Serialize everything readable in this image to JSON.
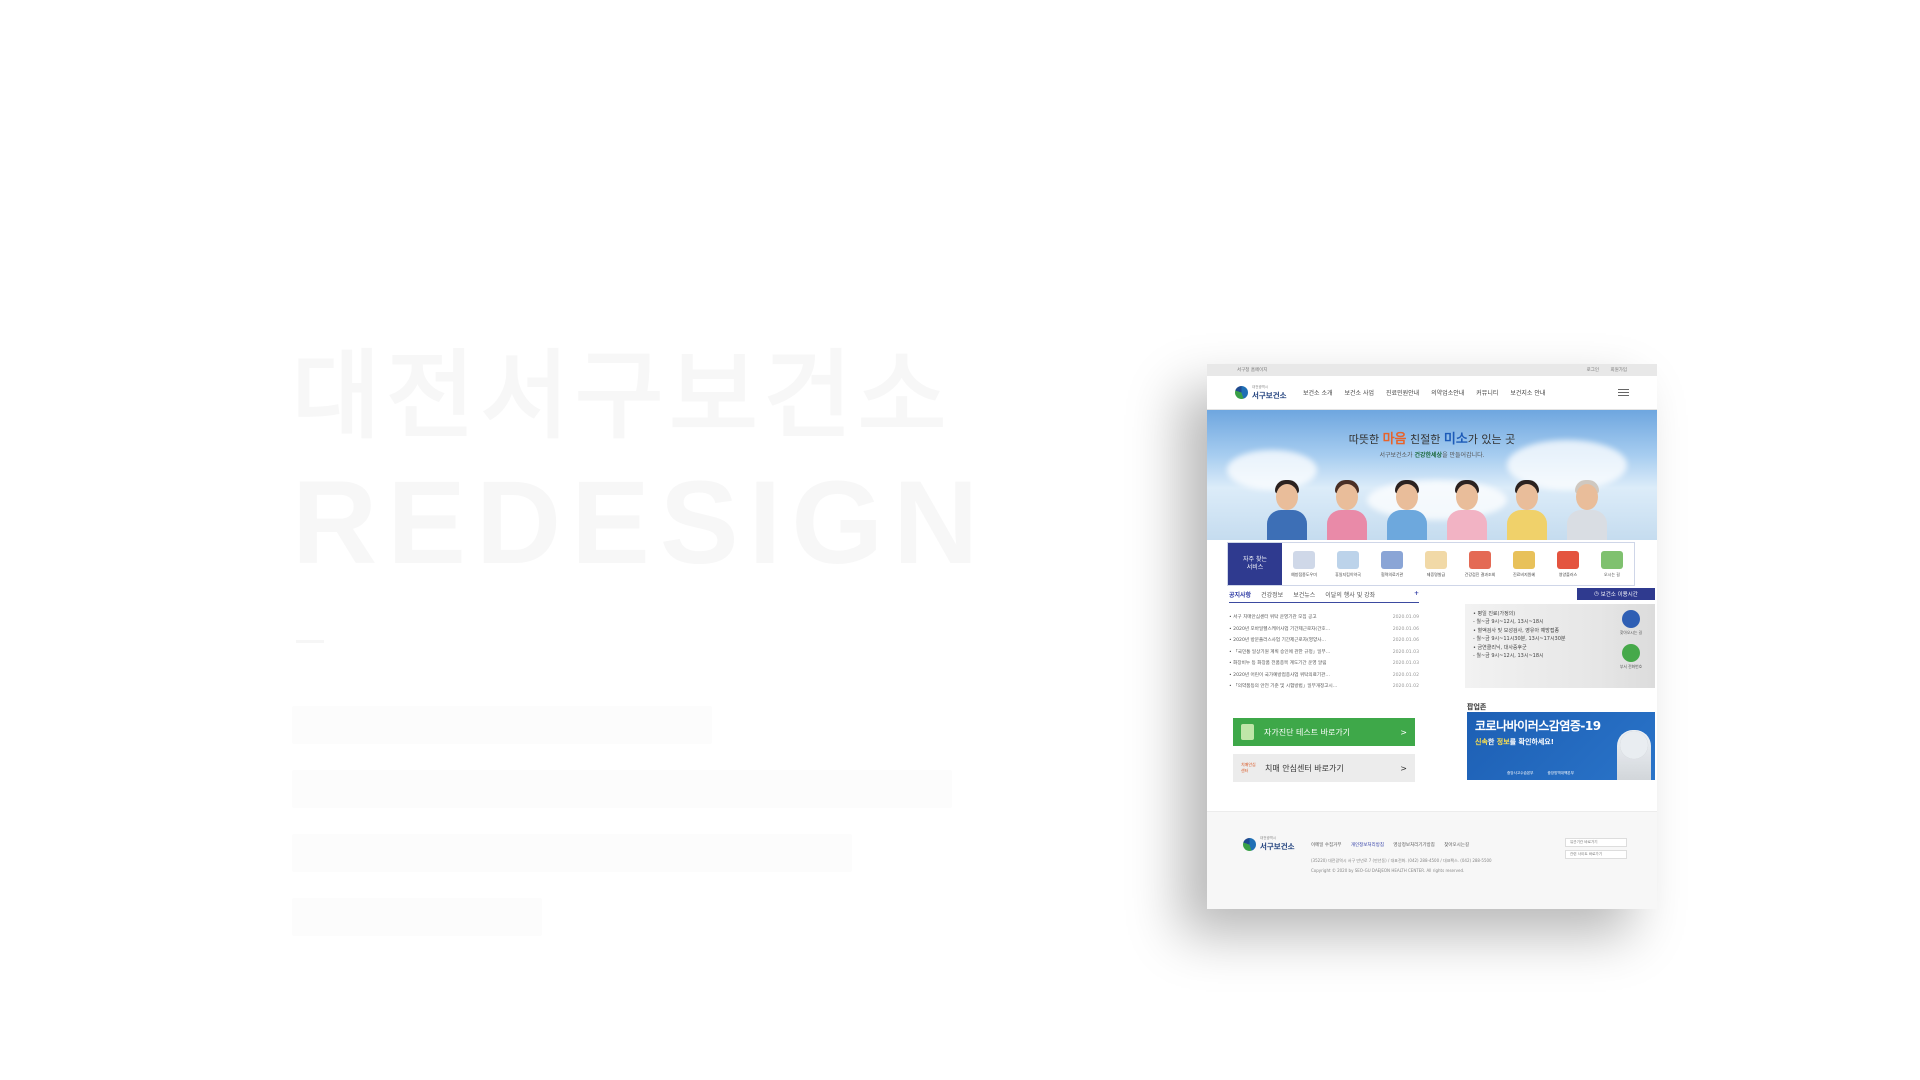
{
  "hero": {
    "title_ko": "대전서구보건소",
    "title_en": "REDESIGN"
  },
  "site": {
    "topbar_left": "서구청 홈페이지",
    "topbar_links": [
      "로그인",
      "회원가입"
    ],
    "logo_small": "대전광역시",
    "logo_name": "서구보건소",
    "menu": [
      "보건소 소개",
      "보건소 사업",
      "진료민원안내",
      "의약업소안내",
      "커뮤니티",
      "보건지소 안내"
    ],
    "banner_head_pre": "따뜻한 ",
    "banner_head_hl1": "마음",
    "banner_head_mid": " 친절한 ",
    "banner_head_hl2": "미소",
    "banner_head_post": "가 있는 곳",
    "banner_sub_pre": "서구보건소가 ",
    "banner_sub_bold": "건강한세상",
    "banner_sub_post": "을 만들어갑니다.",
    "quick_title": [
      "자주 찾는",
      "서비스"
    ],
    "quick_items": [
      {
        "label": "예방접종도우미",
        "color": "#cfd8e8"
      },
      {
        "label": "휴일지킴이약국",
        "color": "#bcd3ea"
      },
      {
        "label": "협력의료기관",
        "color": "#8aa5d6"
      },
      {
        "label": "제증명발급",
        "color": "#f1d9a7"
      },
      {
        "label": "건강검진 결과조회",
        "color": "#e46a55"
      },
      {
        "label": "진료비지원혜",
        "color": "#e8c15a"
      },
      {
        "label": "영양플러스",
        "color": "#e4543f"
      },
      {
        "label": "오시는 길",
        "color": "#7fc16f"
      }
    ],
    "tabs": [
      "공지사항",
      "건강정보",
      "보건뉴스",
      "이달의 행사 및 강좌"
    ],
    "tab_more": "+",
    "notices": [
      {
        "title": "서구 치매안심센터 위탁 운영기관 모집 공고",
        "date": "2020.01.09"
      },
      {
        "title": "2020년 모바일헬스케어사업 기간제근로자(간호…",
        "date": "2020.01.06"
      },
      {
        "title": "2020년 방문플러스사업 기간제근로자(영양사…",
        "date": "2020.01.06"
      },
      {
        "title": "「국민통 일상기원 계획 승인에 관한 규정」일부…",
        "date": "2020.01.03"
      },
      {
        "title": "화장비누 등 화장품 전품종목 계도기간 운영 알림",
        "date": "2020.01.03"
      },
      {
        "title": "2020년 어린이 국가예방접종사업 위탁의료기관…",
        "date": "2020.01.02"
      },
      {
        "title": "「의약품등의 안전 기준 및 시험방법」일부개정고시…",
        "date": "2020.01.02"
      }
    ],
    "hours_title": "보건소 이용시간",
    "hours_lines": [
      "• 평일 진료(가정의)",
      "  - 월~금 9시~12시, 13시~18시",
      "• 혈액검사 및 모성검사, 영유아 예방접종",
      "  - 월~금 9시~11시30분, 13시~17시30분",
      "• 금연클리닉, 대사증후군",
      "  - 월~금 9시~12시, 13시~18시"
    ],
    "hours_icon_labels": [
      "찾아오시는 길",
      "부서 전화번호"
    ],
    "btn_selftest": "자가진단 테스트 바로가기",
    "btn_dementia": "치매 안심센터 바로가기",
    "btn_arrow": ">",
    "dementia_logo": "치매안심센터",
    "popup_title": "팝업존",
    "popup_head": "코로나바이러스감염증-19",
    "popup_sub_hl1": "신속",
    "popup_sub_mid1": "한 ",
    "popup_sub_hl2": "정보",
    "popup_sub_post": "를 확인하세요!",
    "popup_orgs": [
      "중앙사고수습본부",
      "중앙방역대책본부"
    ],
    "footer_links": [
      "이메일 수집거부",
      "개인정보처리방침",
      "영상정보처리기기방침",
      "찾아오시는길"
    ],
    "footer_addr": "(35220) 대전광역시 서구 만년로 7 (만년동) / 대표전화. (042) 288-4500 / 대표팩스. (042) 288-5500",
    "footer_copy": "Copyright © 2020 by SEO-GU DAEJEON HEALTH CENTER. All rights reserved.",
    "footer_selects": [
      "유관기관 바로가기",
      "관련 사이트 바로가기"
    ]
  },
  "colors": {
    "brand_navy": "#2f3a8f",
    "green": "#3ea849",
    "popup_blue": "#1d5fb4"
  }
}
